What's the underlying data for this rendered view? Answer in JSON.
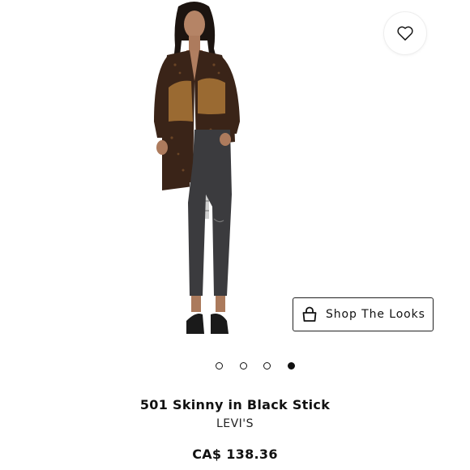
{
  "product": {
    "name": "501 Skinny in Black Stick",
    "brand": "LEVI'S",
    "price": "CA$ 138.36"
  },
  "actions": {
    "wishlist_icon": "heart-icon",
    "shop_looks_label": "Shop The Looks",
    "shop_looks_icon": "shopping-bag-icon"
  },
  "carousel": {
    "total": 4,
    "active_index": 4
  },
  "colors": {
    "text": "#111111",
    "accent": "#000000"
  }
}
